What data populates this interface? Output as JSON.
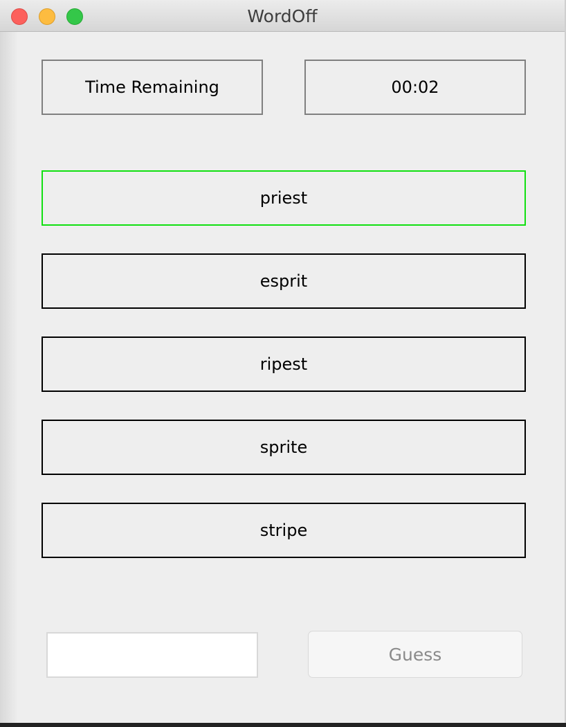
{
  "window": {
    "title": "WordOff"
  },
  "timer": {
    "label": "Time Remaining",
    "value": "00:02"
  },
  "words": [
    {
      "text": "priest",
      "status": "correct"
    },
    {
      "text": "esprit",
      "status": "normal"
    },
    {
      "text": "ripest",
      "status": "normal"
    },
    {
      "text": "sprite",
      "status": "normal"
    },
    {
      "text": "stripe",
      "status": "normal"
    }
  ],
  "guess": {
    "input_value": "",
    "button_label": "Guess"
  },
  "colors": {
    "correct_border": "#10e010",
    "normal_border": "#000000",
    "background": "#eeeeee"
  }
}
